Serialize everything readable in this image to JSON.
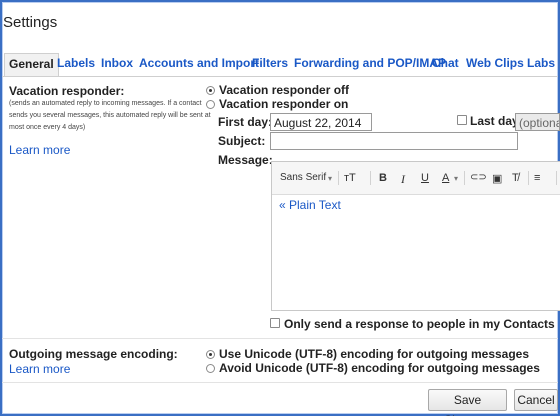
{
  "page": {
    "title": "Settings"
  },
  "tabs": [
    {
      "label": "General",
      "active": true
    },
    {
      "label": "Labels"
    },
    {
      "label": "Inbox"
    },
    {
      "label": "Accounts and Import"
    },
    {
      "label": "Filters"
    },
    {
      "label": "Forwarding and POP/IMAP"
    },
    {
      "label": "Chat"
    },
    {
      "label": "Web Clips"
    },
    {
      "label": "Labs"
    }
  ],
  "vacation": {
    "label": "Vacation responder:",
    "description": [
      "(sends an automated reply to incoming messages. If a contact",
      "sends you several messages, this automated reply will be sent at",
      "most once every 4 days)"
    ],
    "learn_more": "Learn more",
    "option_off": "Vacation responder off",
    "option_on": "Vacation responder on",
    "selected": "off",
    "first_day_label": "First day:",
    "first_day_value": "August 22, 2014",
    "last_day_label": "Last day:",
    "last_day_placeholder": "(optional)",
    "last_day_checked": false,
    "subject_label": "Subject:",
    "subject_value": "",
    "message_label": "Message:",
    "toolbar": {
      "font": "Sans Serif",
      "font_dropdown": "▾",
      "size": "тT",
      "bold": "B",
      "italic": "I",
      "underline": "U",
      "text_color": "A",
      "link": "⊂⊃",
      "image": "▣",
      "remove_format": "T̸",
      "align": "≡",
      "list": "⋮≡"
    },
    "plain_text_link": "« Plain Text",
    "contacts_only_label": "Only send a response to people in my Contacts",
    "contacts_only_checked": false
  },
  "encoding": {
    "label": "Outgoing message encoding:",
    "learn_more": "Learn more",
    "option_utf8": "Use Unicode (UTF-8) encoding for outgoing messages",
    "option_avoid": "Avoid Unicode (UTF-8) encoding for outgoing messages",
    "selected": "utf8"
  },
  "actions": {
    "save": "Save Changes",
    "cancel": "Cancel"
  },
  "colors": {
    "frame_border": "#3a6fc4",
    "link": "#1a58c6"
  }
}
